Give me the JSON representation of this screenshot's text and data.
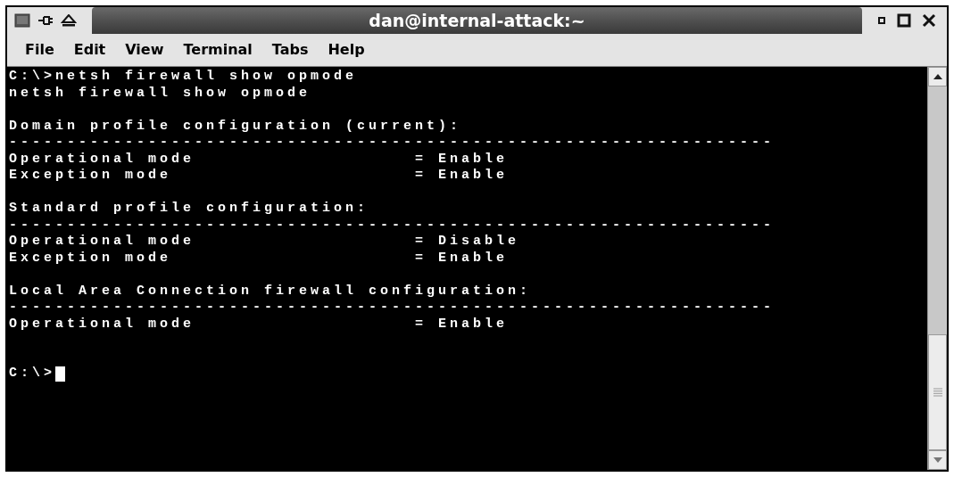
{
  "window": {
    "title": "dan@internal-attack:~"
  },
  "menu": [
    {
      "label": "File"
    },
    {
      "label": "Edit"
    },
    {
      "label": "View"
    },
    {
      "label": "Terminal"
    },
    {
      "label": "Tabs"
    },
    {
      "label": "Help"
    }
  ],
  "terminal": {
    "lines": [
      {
        "kind": "text",
        "text": "C:\\>netsh firewall show opmode"
      },
      {
        "kind": "text",
        "text": "netsh firewall show opmode"
      },
      {
        "kind": "blank"
      },
      {
        "kind": "text",
        "text": "Domain profile configuration (current):"
      },
      {
        "kind": "text",
        "text": "------------------------------------------------------------------"
      },
      {
        "kind": "text",
        "text": "Operational mode                   = Enable"
      },
      {
        "kind": "text",
        "text": "Exception mode                     = Enable"
      },
      {
        "kind": "blank"
      },
      {
        "kind": "text",
        "text": "Standard profile configuration:"
      },
      {
        "kind": "text",
        "text": "------------------------------------------------------------------"
      },
      {
        "kind": "text",
        "text": "Operational mode                   = Disable"
      },
      {
        "kind": "text",
        "text": "Exception mode                     = Enable"
      },
      {
        "kind": "blank"
      },
      {
        "kind": "text",
        "text": "Local Area Connection firewall configuration:"
      },
      {
        "kind": "text",
        "text": "------------------------------------------------------------------"
      },
      {
        "kind": "text",
        "text": "Operational mode                   = Enable"
      },
      {
        "kind": "blank"
      },
      {
        "kind": "blank"
      },
      {
        "kind": "prompt",
        "text": "C:\\>"
      }
    ]
  }
}
